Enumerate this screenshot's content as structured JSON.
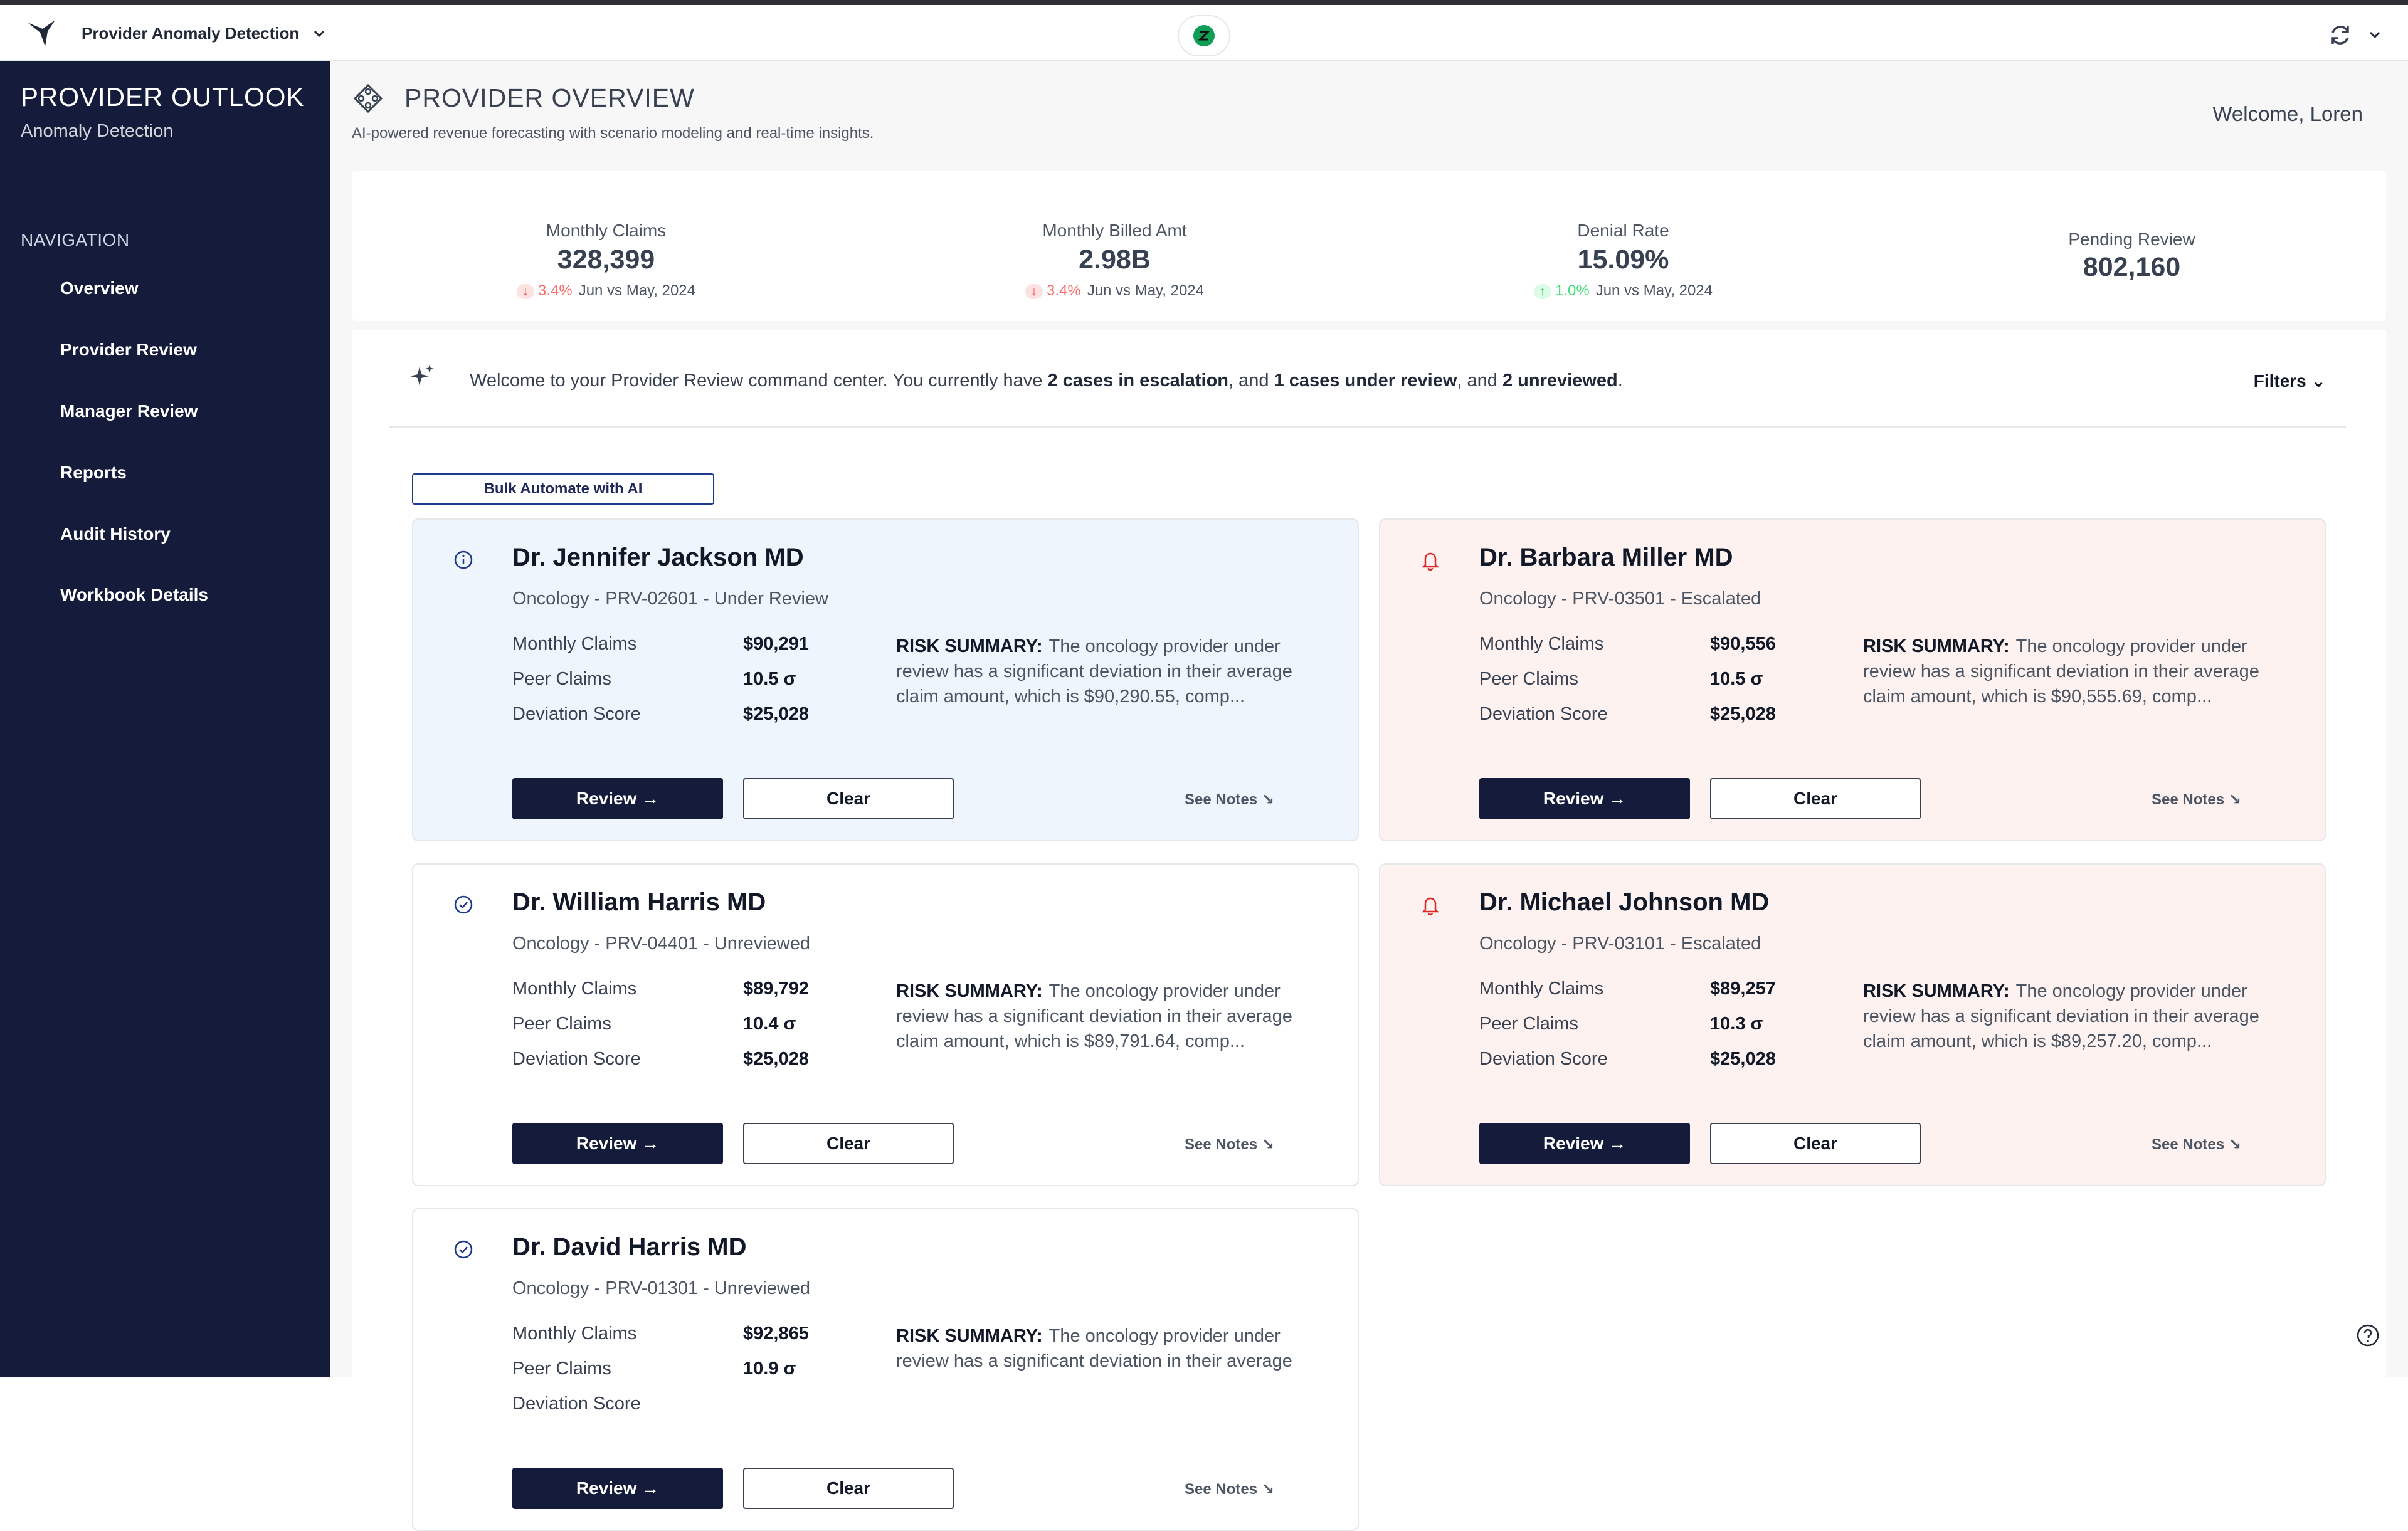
{
  "topbar": {
    "app_title": "Provider Anomaly Detection"
  },
  "sidebar": {
    "brand_title": "PROVIDER OUTLOOK",
    "brand_sub": "Anomaly Detection",
    "nav_heading": "NAVIGATION",
    "items": [
      {
        "label": "Overview"
      },
      {
        "label": "Provider Review"
      },
      {
        "label": "Manager Review"
      },
      {
        "label": "Reports"
      },
      {
        "label": "Audit History"
      },
      {
        "label": "Workbook Details"
      }
    ]
  },
  "header": {
    "title": "PROVIDER OVERVIEW",
    "subtitle": "AI-powered revenue forecasting with scenario modeling and real-time insights.",
    "welcome": "Welcome, Loren"
  },
  "kpis": [
    {
      "label": "Monthly Claims",
      "value": "328,399",
      "pct": "3.4%",
      "period": "Jun vs May, 2024",
      "direction": "down"
    },
    {
      "label": "Monthly Billed Amt",
      "value": "2.98B",
      "pct": "3.4%",
      "period": "Jun vs May, 2024",
      "direction": "down"
    },
    {
      "label": "Denial Rate",
      "value": "15.09%",
      "pct": "1.0%",
      "period": "Jun vs May, 2024",
      "direction": "up"
    },
    {
      "label": "Pending Review",
      "value": "802,160"
    }
  ],
  "welcome_bar": {
    "msg_a": "Welcome to your Provider Review command center. You currently have ",
    "msg_b": "2 cases in escalation",
    "msg_c": ", and ",
    "msg_d": "1 cases under review",
    "msg_e": ", and ",
    "msg_f": "2 unreviewed",
    "msg_g": ".",
    "filters": "Filters ⌄"
  },
  "bulk_button": "Bulk Automate with AI",
  "card_labels": {
    "monthly_claims": "Monthly Claims",
    "peer_claims": "Peer Claims",
    "deviation": "Deviation Score",
    "risk_label": "RISK SUMMARY:",
    "review": "Review →",
    "clear": "Clear",
    "notes": "See Notes ↘"
  },
  "cards": [
    {
      "name": "Dr. Jennifer Jackson MD",
      "meta": "Oncology - PRV-02601 - Under Review",
      "status": "review",
      "monthly_claims": "$90,291",
      "peer_claims": "10.5 σ",
      "deviation": "$25,028",
      "risk": "The oncology provider under review has a significant deviation in their average claim amount, which is $90,290.55, comp..."
    },
    {
      "name": "Dr. Barbara Miller MD",
      "meta": "Oncology - PRV-03501 - Escalated",
      "status": "escalated",
      "monthly_claims": "$90,556",
      "peer_claims": "10.5 σ",
      "deviation": "$25,028",
      "risk": "The oncology provider under review has a significant deviation in their average claim amount, which is $90,555.69, comp..."
    },
    {
      "name": "Dr. William Harris MD",
      "meta": "Oncology - PRV-04401 - Unreviewed",
      "status": "unreviewed",
      "monthly_claims": "$89,792",
      "peer_claims": "10.4 σ",
      "deviation": "$25,028",
      "risk": "The oncology provider under review has a significant deviation in their average claim amount, which is $89,791.64, comp..."
    },
    {
      "name": "Dr. Michael Johnson MD",
      "meta": "Oncology - PRV-03101 - Escalated",
      "status": "escalated",
      "monthly_claims": "$89,257",
      "peer_claims": "10.3 σ",
      "deviation": "$25,028",
      "risk": "The oncology provider under review has a significant deviation in their average claim amount, which is $89,257.20, comp..."
    },
    {
      "name": "Dr. David Harris MD",
      "meta": "Oncology - PRV-01301 - Unreviewed",
      "status": "unreviewed",
      "monthly_claims": "$92,865",
      "peer_claims": "10.9 σ",
      "deviation": "",
      "risk": "The oncology provider under review has a significant deviation in their average"
    }
  ],
  "colors": {
    "sidebar_bg": "#151b3a",
    "review_card_bg": "#eff5fd",
    "escalated_card_bg": "#fdf2ef",
    "escalated_icon": "#dc2626",
    "review_icon": "#1e3a8a"
  }
}
